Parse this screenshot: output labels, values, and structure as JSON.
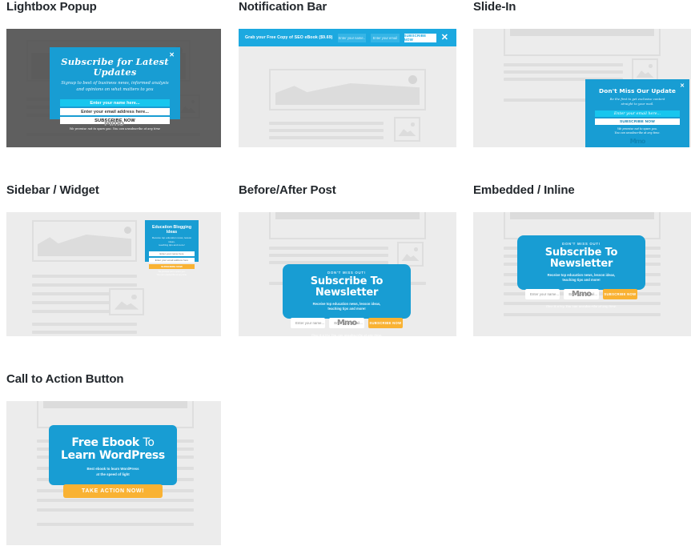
{
  "page": {
    "accent_blue": "#189dd3",
    "accent_cyan": "#17c6ee",
    "accent_amber": "#f9b233",
    "mock_bg": "#ececec",
    "wire_gray": "#dedede"
  },
  "sections": [
    {
      "id": "lightbox-popup",
      "title": "Lightbox Popup"
    },
    {
      "id": "notification-bar",
      "title": "Notification Bar"
    },
    {
      "id": "slide-in",
      "title": "Slide-In"
    },
    {
      "id": "sidebar-widget",
      "title": "Sidebar / Widget"
    },
    {
      "id": "before-after",
      "title": "Before/After Post"
    },
    {
      "id": "embedded-inline",
      "title": "Embedded / Inline"
    },
    {
      "id": "cta-button",
      "title": "Call to Action Button"
    }
  ],
  "lightbox": {
    "title": "Subscribe for Latest Updates",
    "subtitle_line1": "Signup to best of business news, informed analysis",
    "subtitle_line2": "and opinions on what matters to you",
    "name_placeholder": "Enter your name here...",
    "email_placeholder": "Enter your email address here...",
    "button_label": "SUBSCRIBE NOW",
    "footnote": "We promise not to spam you. You can unsubscribe at any time",
    "close_icon": "close-icon",
    "brand": "Mmo"
  },
  "notification": {
    "headline": "Grab your Free Copy of SEO eBook ($9.69)",
    "name_placeholder": "Enter your name..",
    "email_placeholder": "Enter your email",
    "button_label": "SUBSCRIBE NOW",
    "close_icon": "close-icon"
  },
  "slidein": {
    "title": "Don't Miss Our Update",
    "subtitle_line1": "Be the first to get exclusive content",
    "subtitle_line2": "straight to your mail.",
    "email_placeholder": "Enter your email here...",
    "button_label": "SUBSCRIBE NOW",
    "footnote_line1": "We promise not to spam you.",
    "footnote_line2": "You can unsubscribe at any time.",
    "close_icon": "close-icon",
    "brand": "Mmo"
  },
  "widget": {
    "title": "Education Blogging Ideas",
    "subtitle_line1": "Receive top education news, lesson ideas,",
    "subtitle_line2": "teaching tips and more!",
    "name_placeholder": "Enter your name here",
    "email_placeholder": "Enter your email address here",
    "button_label": "SUBSCRIBE NOW",
    "footnote_line1": "We promise not to spam you.",
    "footnote_line2": "You can unsubscribe at any time."
  },
  "newsletter": {
    "kicker": "DON'T MISS OUT!",
    "title": "Subscribe To Newsletter",
    "subtitle_line1": "Receive top education news, lesson ideas,",
    "subtitle_line2": "teaching tips and more!",
    "name_placeholder": "Enter your name...",
    "email_placeholder": "Enter your email...",
    "button_label": "SUBSCRIBE NOW",
    "footnote": "Give it a try. You can unsubscribe at any time.",
    "brand": "Mmo"
  },
  "cta": {
    "title_line1_strong": "Free Ebook",
    "title_line1_light": "To",
    "title_line2": "Learn WordPress",
    "subtitle_line1": "Best ebook to learn WordPress",
    "subtitle_line2": "at the speed of light",
    "button_label": "TAKE ACTION NOW!"
  }
}
